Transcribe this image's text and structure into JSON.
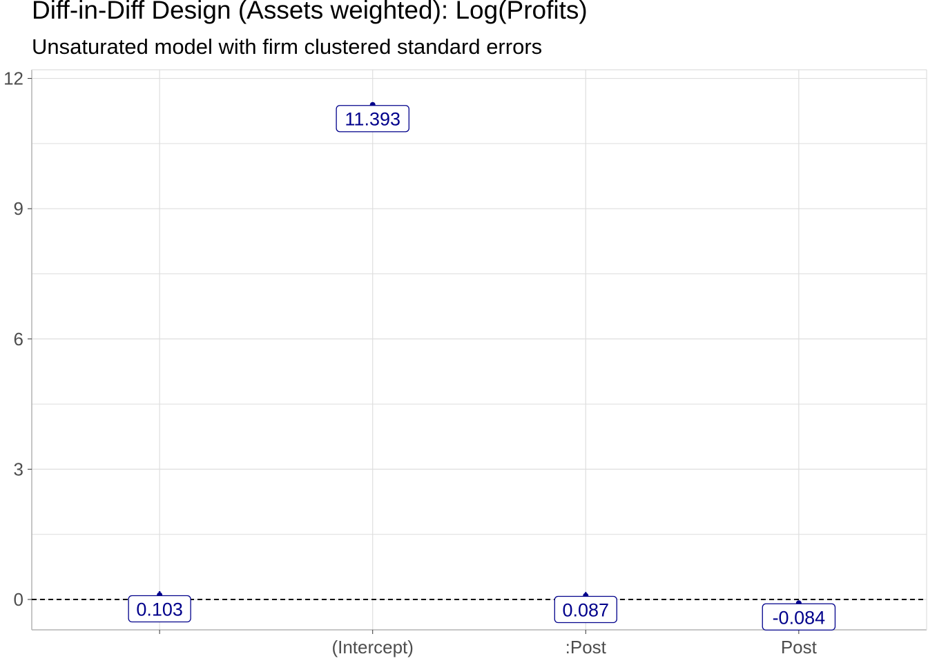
{
  "chart_data": {
    "type": "scatter",
    "title": "Diff-in-Diff Design (Assets weighted): Log(Profits)",
    "subtitle": "Unsaturated model with firm clustered standard errors",
    "xlabel": "",
    "ylabel": "",
    "categories": [
      "",
      "(Intercept)",
      ":Post",
      "Post"
    ],
    "values": [
      0.103,
      11.393,
      0.087,
      -0.084
    ],
    "labels": [
      "0.103",
      "11.393",
      "0.087",
      "-0.084"
    ],
    "error_bars": [
      [
        0.02,
        0.19
      ],
      [
        11.35,
        11.44
      ],
      [
        0.01,
        0.17
      ],
      [
        -0.12,
        -0.04
      ]
    ],
    "ylim": [
      -0.7,
      12.2
    ],
    "yticks": [
      0,
      3,
      6,
      9,
      12
    ],
    "ytick_labels": [
      "0",
      "3",
      "6",
      "9",
      "12"
    ],
    "reference_line": 0,
    "grid": true,
    "colors": {
      "point": "#00008b",
      "label_text": "#00008b",
      "grid": "#dedede",
      "axis": "#b3b3b3"
    }
  }
}
